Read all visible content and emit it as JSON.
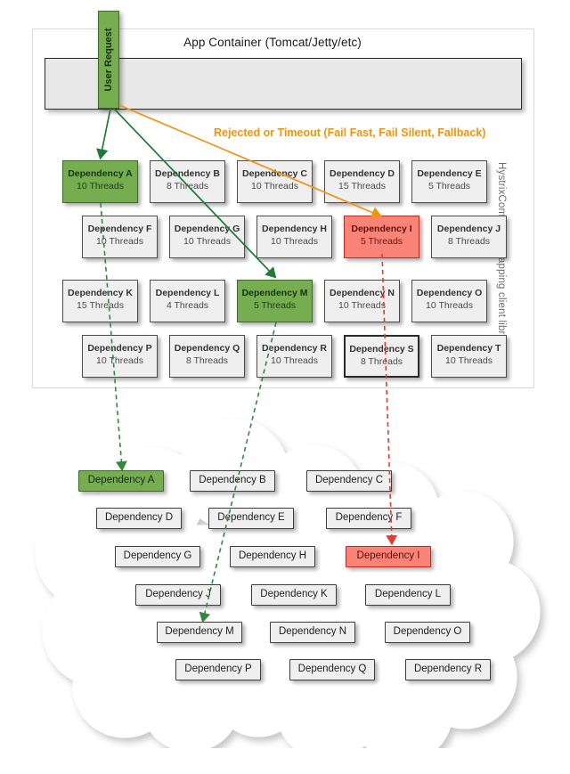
{
  "diagram": {
    "user_request": {
      "label": "User Request",
      "color": "#76ad50"
    },
    "app_container": {
      "title": "App Container (Tomcat/Jetty/etc)"
    },
    "rejected_label": {
      "text": "Rejected or Timeout (Fail Fast, Fail Silent, Fallback)",
      "color": "#f2930d"
    },
    "side_label": {
      "text": "HystrixCommand wrapping client libraries"
    },
    "colors": {
      "green": "#76ad50",
      "red": "#fb8377",
      "orange": "#f2930d",
      "gray_box": "#efefef",
      "container_bar": "#e8e8e8"
    },
    "thread_pools": [
      {
        "name": "Dependency A",
        "threads": "10 Threads",
        "state": "green"
      },
      {
        "name": "Dependency B",
        "threads": "8 Threads",
        "state": "normal"
      },
      {
        "name": "Dependency C",
        "threads": "10 Threads",
        "state": "normal"
      },
      {
        "name": "Dependency D",
        "threads": "15 Threads",
        "state": "normal"
      },
      {
        "name": "Dependency E",
        "threads": "5 Threads",
        "state": "normal"
      },
      {
        "name": "Dependency F",
        "threads": "10 Threads",
        "state": "normal"
      },
      {
        "name": "Dependency G",
        "threads": "10 Threads",
        "state": "normal"
      },
      {
        "name": "Dependency H",
        "threads": "10 Threads",
        "state": "normal"
      },
      {
        "name": "Dependency I",
        "threads": "5 Threads",
        "state": "red"
      },
      {
        "name": "Dependency J",
        "threads": "8 Threads",
        "state": "normal"
      },
      {
        "name": "Dependency K",
        "threads": "15 Threads",
        "state": "normal"
      },
      {
        "name": "Dependency L",
        "threads": "4 Threads",
        "state": "normal"
      },
      {
        "name": "Dependency M",
        "threads": "5 Threads",
        "state": "green"
      },
      {
        "name": "Dependency N",
        "threads": "10 Threads",
        "state": "normal"
      },
      {
        "name": "Dependency O",
        "threads": "10 Threads",
        "state": "normal"
      },
      {
        "name": "Dependency P",
        "threads": "10 Threads",
        "state": "normal"
      },
      {
        "name": "Dependency Q",
        "threads": "8 Threads",
        "state": "normal"
      },
      {
        "name": "Dependency R",
        "threads": "10 Threads",
        "state": "normal"
      },
      {
        "name": "Dependency S",
        "threads": "8 Threads",
        "state": "emphasis"
      },
      {
        "name": "Dependency T",
        "threads": "10 Threads",
        "state": "normal"
      }
    ],
    "cloud_services": [
      {
        "name": "Dependency A",
        "state": "green"
      },
      {
        "name": "Dependency B",
        "state": "normal"
      },
      {
        "name": "Dependency C",
        "state": "normal"
      },
      {
        "name": "Dependency D",
        "state": "normal"
      },
      {
        "name": "Dependency E",
        "state": "normal"
      },
      {
        "name": "Dependency F",
        "state": "normal"
      },
      {
        "name": "Dependency G",
        "state": "normal"
      },
      {
        "name": "Dependency H",
        "state": "normal"
      },
      {
        "name": "Dependency I",
        "state": "red"
      },
      {
        "name": "Dependency J",
        "state": "normal"
      },
      {
        "name": "Dependency K",
        "state": "normal"
      },
      {
        "name": "Dependency L",
        "state": "normal"
      },
      {
        "name": "Dependency M",
        "state": "normal"
      },
      {
        "name": "Dependency N",
        "state": "normal"
      },
      {
        "name": "Dependency O",
        "state": "normal"
      },
      {
        "name": "Dependency P",
        "state": "normal"
      },
      {
        "name": "Dependency Q",
        "state": "normal"
      },
      {
        "name": "Dependency R",
        "state": "normal"
      }
    ]
  }
}
